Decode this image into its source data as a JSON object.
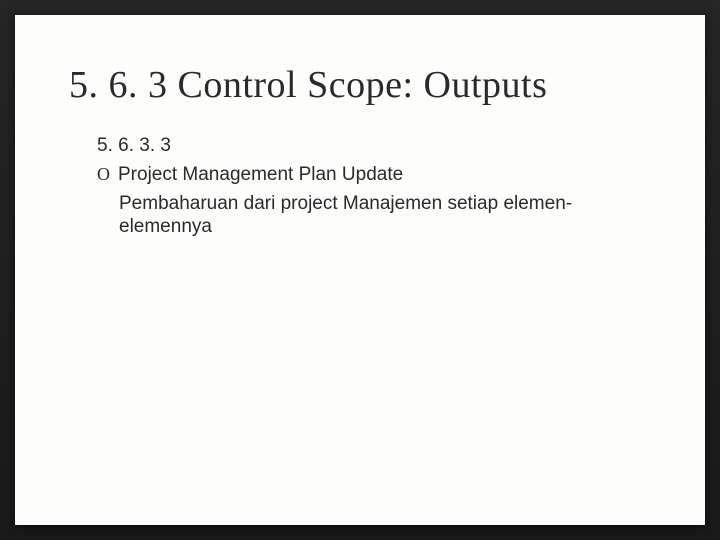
{
  "slide": {
    "title": "5. 6. 3 Control Scope: Outputs",
    "section_number": "5. 6. 3. 3",
    "bullet_marker": "O",
    "bullet_text": "Project Management Plan Update",
    "description": "Pembaharuan dari project Manajemen setiap elemen-elemennya"
  }
}
